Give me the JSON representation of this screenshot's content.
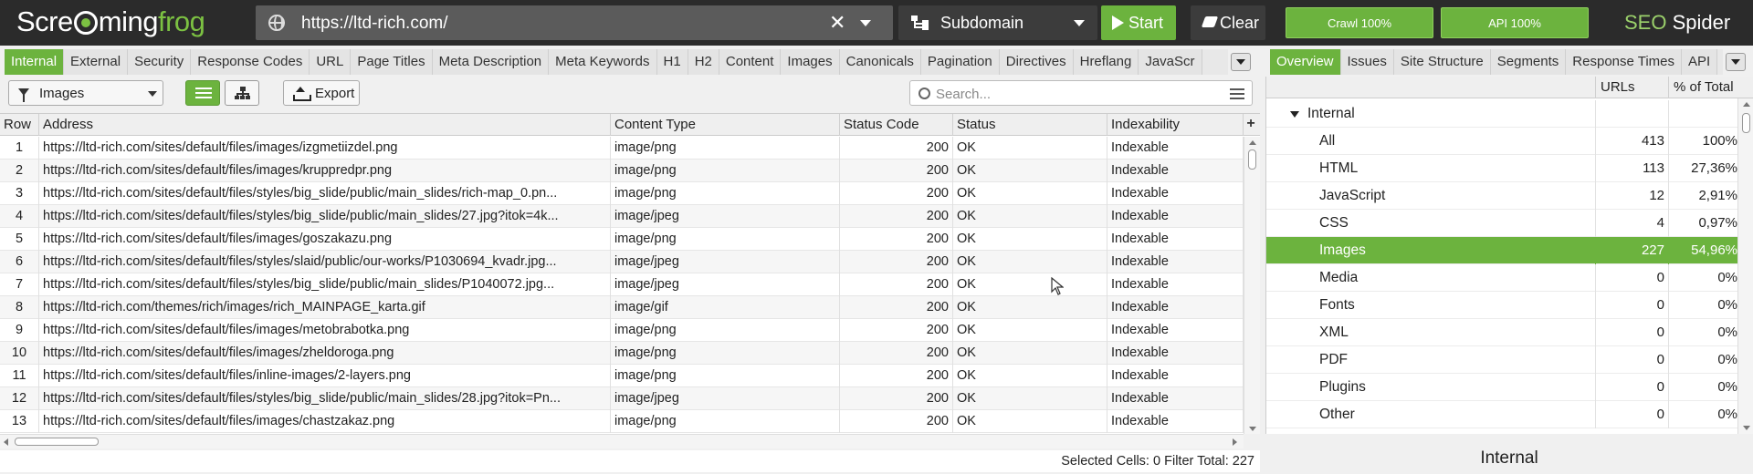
{
  "app": {
    "logo_left": "Scre",
    "logo_mid": "ming",
    "logo_right": "frog",
    "brand_seo": "SEO",
    "brand_spider": " Spider"
  },
  "topbar": {
    "url": "https://ltd-rich.com/",
    "mode": "Subdomain",
    "start_label": "Start",
    "clear_label": "Clear",
    "crawl_status": "Crawl 100%",
    "api_status": "API 100%"
  },
  "colors": {
    "accent": "#6cb33e",
    "topbar_bg": "#2b2b2b"
  },
  "left_tabs": [
    "Internal",
    "External",
    "Security",
    "Response Codes",
    "URL",
    "Page Titles",
    "Meta Description",
    "Meta Keywords",
    "H1",
    "H2",
    "Content",
    "Images",
    "Canonicals",
    "Pagination",
    "Directives",
    "Hreflang",
    "JavaScr"
  ],
  "left_tab_active": "Internal",
  "right_tabs": [
    "Overview",
    "Issues",
    "Site Structure",
    "Segments",
    "Response Times",
    "API"
  ],
  "right_tab_active": "Overview",
  "toolbar": {
    "filter_value": "Images",
    "export_label": "Export",
    "search_placeholder": "Search..."
  },
  "table": {
    "columns": [
      "Row",
      "Address",
      "Content Type",
      "Status Code",
      "Status",
      "Indexability"
    ],
    "rows": [
      [
        "1",
        "https://ltd-rich.com/sites/default/files/images/izgmetiizdel.png",
        "image/png",
        "200",
        "OK",
        "Indexable"
      ],
      [
        "2",
        "https://ltd-rich.com/sites/default/files/images/kruppredpr.png",
        "image/png",
        "200",
        "OK",
        "Indexable"
      ],
      [
        "3",
        "https://ltd-rich.com/sites/default/files/styles/big_slide/public/main_slides/rich-map_0.pn...",
        "image/png",
        "200",
        "OK",
        "Indexable"
      ],
      [
        "4",
        "https://ltd-rich.com/sites/default/files/styles/big_slide/public/main_slides/27.jpg?itok=4k...",
        "image/jpeg",
        "200",
        "OK",
        "Indexable"
      ],
      [
        "5",
        "https://ltd-rich.com/sites/default/files/images/goszakazu.png",
        "image/png",
        "200",
        "OK",
        "Indexable"
      ],
      [
        "6",
        "https://ltd-rich.com/sites/default/files/styles/slaid/public/our-works/P1030694_kvadr.jpg...",
        "image/jpeg",
        "200",
        "OK",
        "Indexable"
      ],
      [
        "7",
        "https://ltd-rich.com/sites/default/files/styles/big_slide/public/main_slides/P1040072.jpg...",
        "image/jpeg",
        "200",
        "OK",
        "Indexable"
      ],
      [
        "8",
        "https://ltd-rich.com/themes/rich/images/rich_MAINPAGE_karta.gif",
        "image/gif",
        "200",
        "OK",
        "Indexable"
      ],
      [
        "9",
        "https://ltd-rich.com/sites/default/files/images/metobrabotka.png",
        "image/png",
        "200",
        "OK",
        "Indexable"
      ],
      [
        "10",
        "https://ltd-rich.com/sites/default/files/images/zheldoroga.png",
        "image/png",
        "200",
        "OK",
        "Indexable"
      ],
      [
        "11",
        "https://ltd-rich.com/sites/default/files/inline-images/2-layers.png",
        "image/png",
        "200",
        "OK",
        "Indexable"
      ],
      [
        "12",
        "https://ltd-rich.com/sites/default/files/styles/big_slide/public/main_slides/28.jpg?itok=Pn...",
        "image/jpeg",
        "200",
        "OK",
        "Indexable"
      ],
      [
        "13",
        "https://ltd-rich.com/sites/default/files/images/chastzakaz.png",
        "image/png",
        "200",
        "OK",
        "Indexable"
      ]
    ]
  },
  "status": {
    "selected_label": "Selected Cells:",
    "selected_value": "0",
    "filter_label": "Filter Total:",
    "filter_value": "227"
  },
  "overview": {
    "col_urls": "URLs",
    "col_pct": "% of Total",
    "group": "Internal",
    "items": [
      {
        "name": "All",
        "urls": "413",
        "pct": "100%"
      },
      {
        "name": "HTML",
        "urls": "113",
        "pct": "27,36%"
      },
      {
        "name": "JavaScript",
        "urls": "12",
        "pct": "2,91%"
      },
      {
        "name": "CSS",
        "urls": "4",
        "pct": "0,97%"
      },
      {
        "name": "Images",
        "urls": "227",
        "pct": "54,96%"
      },
      {
        "name": "Media",
        "urls": "0",
        "pct": "0%"
      },
      {
        "name": "Fonts",
        "urls": "0",
        "pct": "0%"
      },
      {
        "name": "XML",
        "urls": "0",
        "pct": "0%"
      },
      {
        "name": "PDF",
        "urls": "0",
        "pct": "0%"
      },
      {
        "name": "Plugins",
        "urls": "0",
        "pct": "0%"
      },
      {
        "name": "Other",
        "urls": "0",
        "pct": "0%"
      }
    ],
    "selected": "Images",
    "chart_title": "Internal"
  }
}
